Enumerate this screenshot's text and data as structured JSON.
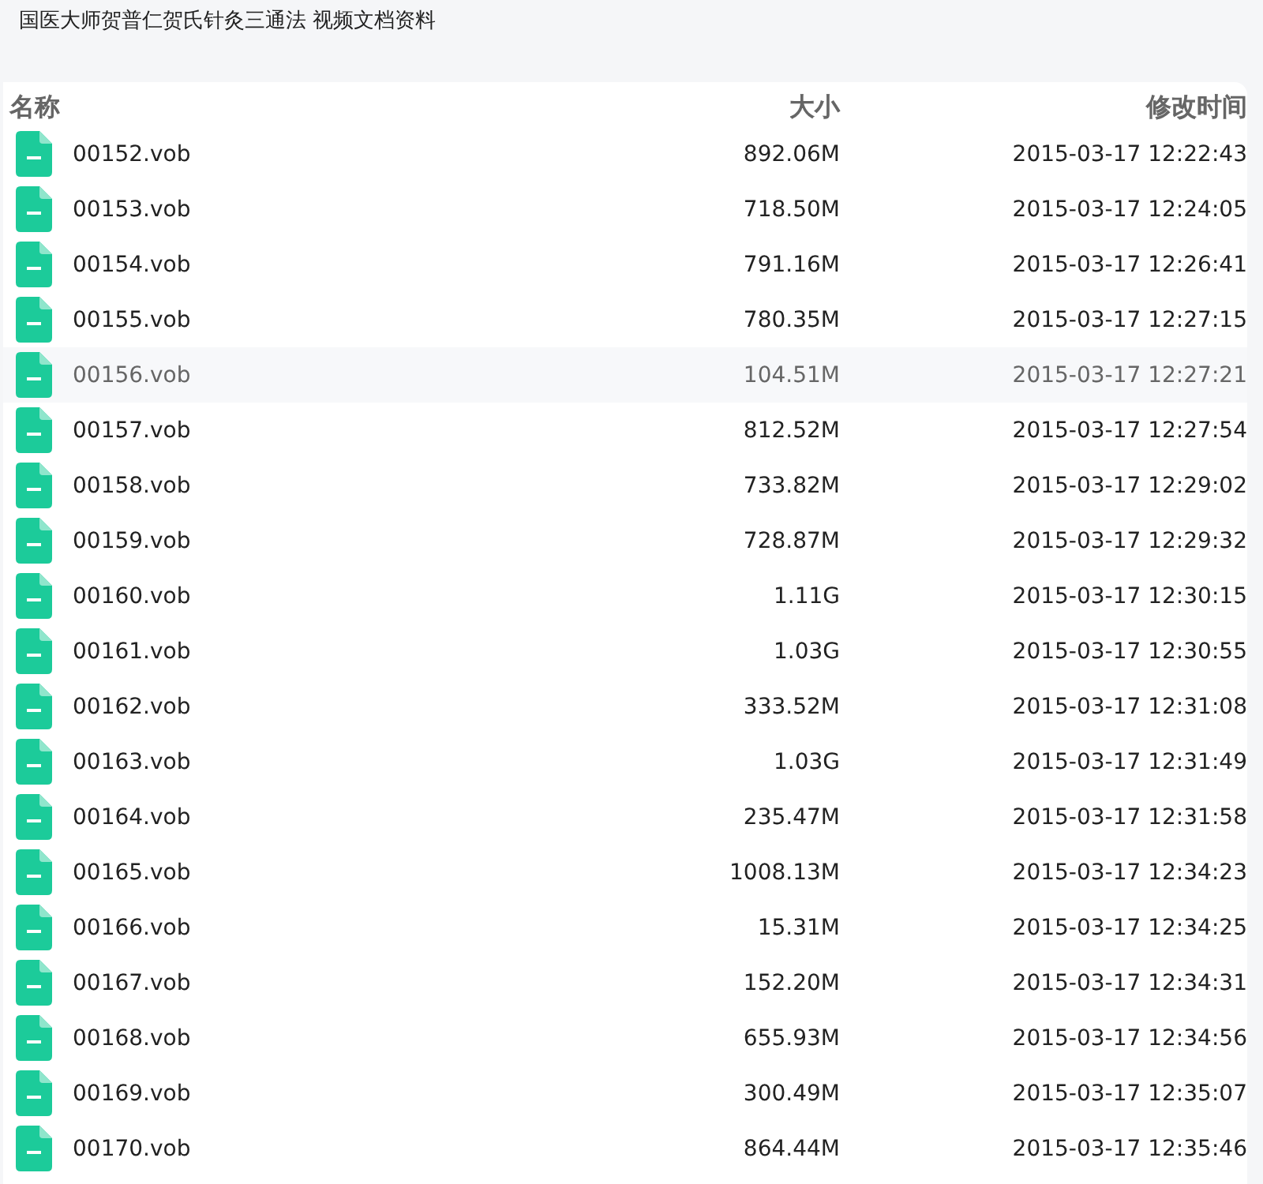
{
  "title": "国医大师贺普仁贺氏针灸三通法 视频文档资料",
  "table": {
    "columns": [
      "名称",
      "大小",
      "修改时间"
    ],
    "rows": [
      {
        "name": "00152.vob",
        "size": "892.06M",
        "modified": "2015-03-17 12:22:43",
        "selected": false
      },
      {
        "name": "00153.vob",
        "size": "718.50M",
        "modified": "2015-03-17 12:24:05",
        "selected": false
      },
      {
        "name": "00154.vob",
        "size": "791.16M",
        "modified": "2015-03-17 12:26:41",
        "selected": false
      },
      {
        "name": "00155.vob",
        "size": "780.35M",
        "modified": "2015-03-17 12:27:15",
        "selected": false
      },
      {
        "name": "00156.vob",
        "size": "104.51M",
        "modified": "2015-03-17 12:27:21",
        "selected": true
      },
      {
        "name": "00157.vob",
        "size": "812.52M",
        "modified": "2015-03-17 12:27:54",
        "selected": false
      },
      {
        "name": "00158.vob",
        "size": "733.82M",
        "modified": "2015-03-17 12:29:02",
        "selected": false
      },
      {
        "name": "00159.vob",
        "size": "728.87M",
        "modified": "2015-03-17 12:29:32",
        "selected": false
      },
      {
        "name": "00160.vob",
        "size": "1.11G",
        "modified": "2015-03-17 12:30:15",
        "selected": false
      },
      {
        "name": "00161.vob",
        "size": "1.03G",
        "modified": "2015-03-17 12:30:55",
        "selected": false
      },
      {
        "name": "00162.vob",
        "size": "333.52M",
        "modified": "2015-03-17 12:31:08",
        "selected": false
      },
      {
        "name": "00163.vob",
        "size": "1.03G",
        "modified": "2015-03-17 12:31:49",
        "selected": false
      },
      {
        "name": "00164.vob",
        "size": "235.47M",
        "modified": "2015-03-17 12:31:58",
        "selected": false
      },
      {
        "name": "00165.vob",
        "size": "1008.13M",
        "modified": "2015-03-17 12:34:23",
        "selected": false
      },
      {
        "name": "00166.vob",
        "size": "15.31M",
        "modified": "2015-03-17 12:34:25",
        "selected": false
      },
      {
        "name": "00167.vob",
        "size": "152.20M",
        "modified": "2015-03-17 12:34:31",
        "selected": false
      },
      {
        "name": "00168.vob",
        "size": "655.93M",
        "modified": "2015-03-17 12:34:56",
        "selected": false
      },
      {
        "name": "00169.vob",
        "size": "300.49M",
        "modified": "2015-03-17 12:35:07",
        "selected": false
      },
      {
        "name": "00170.vob",
        "size": "864.44M",
        "modified": "2015-03-17 12:35:46",
        "selected": false
      }
    ]
  }
}
